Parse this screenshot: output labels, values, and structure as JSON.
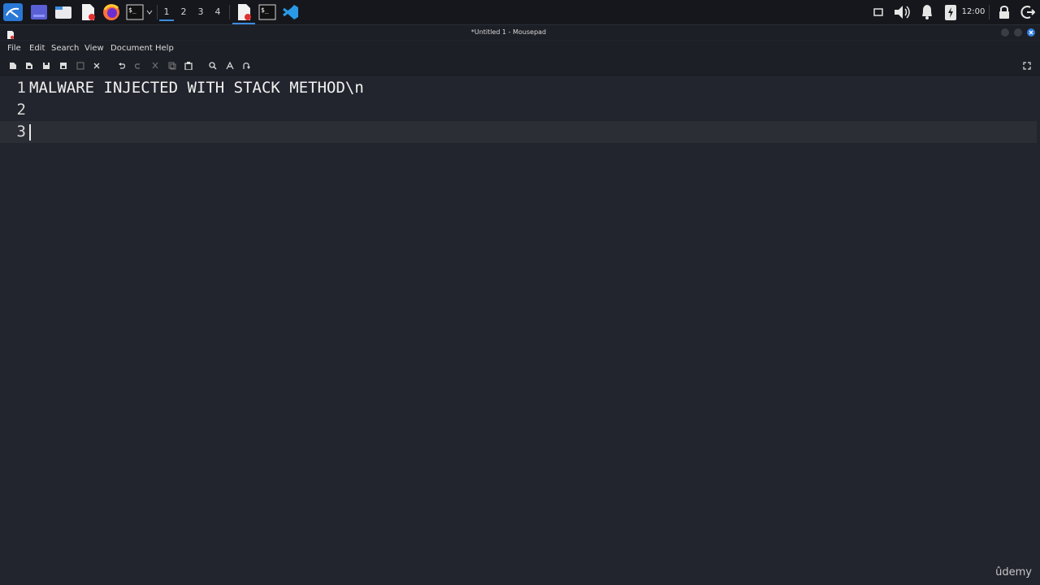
{
  "panel": {
    "workspaces": [
      "1",
      "2",
      "3",
      "4"
    ],
    "clock": "12:00"
  },
  "window": {
    "title": "*Untitled 1 - Mousepad"
  },
  "menu": {
    "items": [
      "File",
      "Edit",
      "Search",
      "View",
      "Document",
      "Help"
    ]
  },
  "editor": {
    "lines": [
      {
        "number": "1",
        "text": "MALWARE INJECTED WITH STACK METHOD\\n"
      },
      {
        "number": "2",
        "text": ""
      },
      {
        "number": "3",
        "text": ""
      }
    ],
    "current_line": 3
  },
  "watermark": "ûdemy",
  "colors": {
    "background": "#23252e",
    "accent": "#3b8de0",
    "close": "#2f7ddf",
    "firefox": "#ff7139",
    "vscode": "#2b9ae6"
  }
}
